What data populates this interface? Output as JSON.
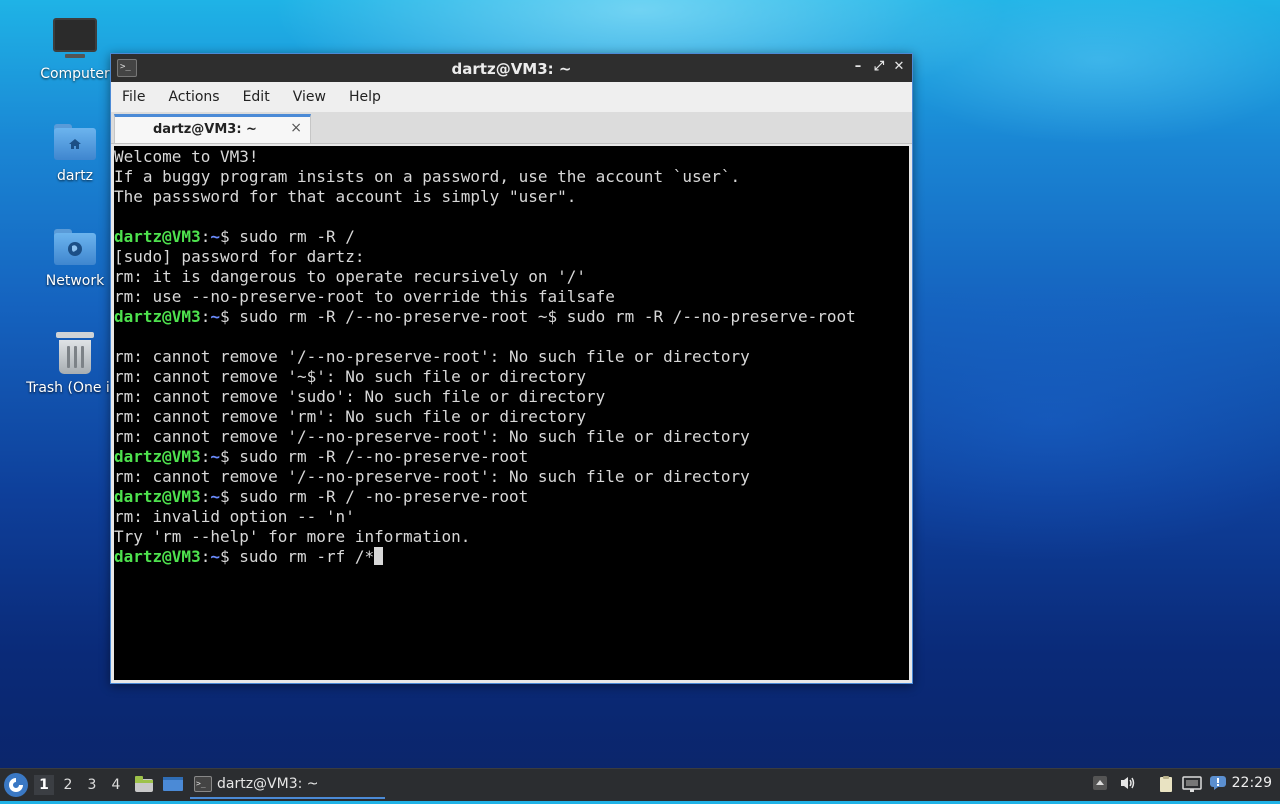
{
  "desktop": {
    "icons": [
      {
        "label": "Computer",
        "icon": "monitor-icon"
      },
      {
        "label": "dartz",
        "icon": "home-folder-icon"
      },
      {
        "label": "Network",
        "icon": "network-folder-icon"
      },
      {
        "label": "Trash (One ite",
        "icon": "trash-icon"
      }
    ]
  },
  "window": {
    "title": "dartz@VM3: ~",
    "app_icon": ">_",
    "controls": {
      "minimize": "–",
      "maximize": "⤢",
      "close": "✕"
    },
    "menu": [
      "File",
      "Actions",
      "Edit",
      "View",
      "Help"
    ],
    "tab": {
      "label": "dartz@VM3: ~",
      "close": "×"
    }
  },
  "terminal": {
    "prompt_user": "dartz@VM3",
    "prompt_sep": ":",
    "prompt_dir": "~",
    "lines": [
      "Welcome to VM3!",
      "If a buggy program insists on a password, use the account `user`.",
      "The passsword for that account is simply \"user\".",
      "",
      "$ sudo rm -R /",
      "[sudo] password for dartz:",
      "rm: it is dangerous to operate recursively on '/'",
      "rm: use --no-preserve-root to override this failsafe",
      "$ sudo rm -R /--no-preserve-root ~$ sudo rm -R /--no-preserve-root",
      "",
      "rm: cannot remove '/--no-preserve-root': No such file or directory",
      "rm: cannot remove '~$': No such file or directory",
      "rm: cannot remove 'sudo': No such file or directory",
      "rm: cannot remove 'rm': No such file or directory",
      "rm: cannot remove '/--no-preserve-root': No such file or directory",
      "$ sudo rm -R /--no-preserve-root",
      "rm: cannot remove '/--no-preserve-root': No such file or directory",
      "$ sudo rm -R / -no-preserve-root",
      "rm: invalid option -- 'n'",
      "Try 'rm --help' for more information.",
      "$ sudo rm -rf /*"
    ],
    "prompt_line_indices": [
      4,
      8,
      15,
      17,
      20
    ],
    "colors": {
      "user": "#4ee24e",
      "dir": "#6b8cff",
      "text": "#d8d8d8",
      "background": "#000000"
    }
  },
  "taskbar": {
    "start_icon": "lxqt-menu-icon",
    "workspaces": [
      "1",
      "2",
      "3",
      "4"
    ],
    "active_workspace": "1",
    "task_label": "dartz@VM3: ~",
    "clock": "22:29"
  }
}
